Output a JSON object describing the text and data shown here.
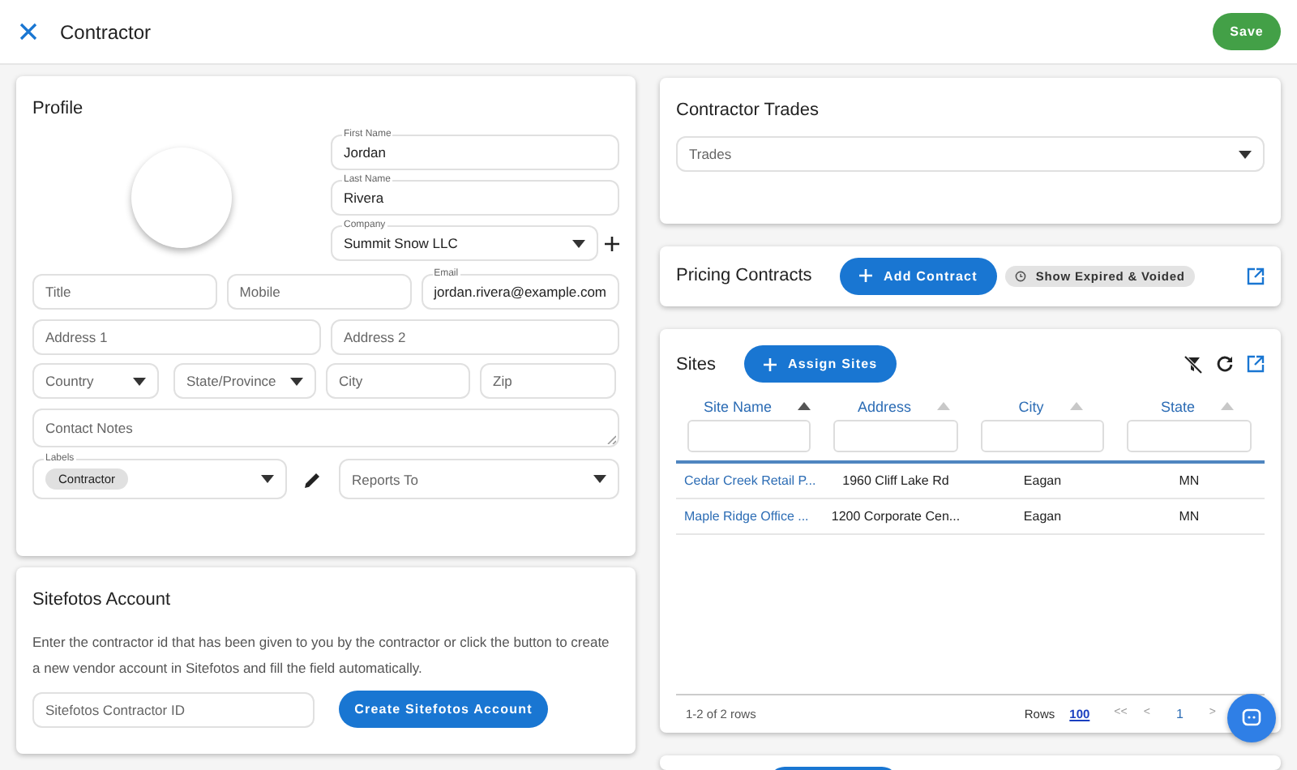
{
  "header": {
    "title": "Contractor",
    "save_button": "Save"
  },
  "profile": {
    "heading": "Profile",
    "first_name": {
      "label": "First Name",
      "value": "Jordan"
    },
    "last_name": {
      "label": "Last Name",
      "value": "Rivera"
    },
    "company": {
      "label": "Company",
      "value": "Summit Snow LLC"
    },
    "title": {
      "placeholder": "Title"
    },
    "mobile": {
      "placeholder": "Mobile"
    },
    "email": {
      "label": "Email",
      "value": "jordan.rivera@example.com"
    },
    "address_1": {
      "placeholder": "Address 1"
    },
    "address_2": {
      "placeholder": "Address 2"
    },
    "country": {
      "placeholder": "Country"
    },
    "state_province": {
      "placeholder": "State/Province"
    },
    "city": {
      "placeholder": "City"
    },
    "zip": {
      "placeholder": "Zip"
    },
    "contact_notes": {
      "placeholder": "Contact Notes"
    },
    "labels": {
      "label": "Labels",
      "chips": [
        "Contractor"
      ]
    },
    "reports_to": {
      "placeholder": "Reports To"
    }
  },
  "sitefotos": {
    "heading": "Sitefotos Account",
    "description": "Enter the contractor id that has been given to you by the contractor or click the button to create a new vendor account in Sitefotos and fill the field automatically.",
    "contractor_id": {
      "placeholder": "Sitefotos Contractor ID"
    },
    "create_button": "Create Sitefotos Account"
  },
  "trades": {
    "heading": "Contractor Trades",
    "trades": {
      "placeholder": "Trades"
    }
  },
  "pricing": {
    "heading": "Pricing Contracts",
    "add_button": "Add Contract",
    "expired_chip": "Show Expired & Voided"
  },
  "sites": {
    "heading": "Sites",
    "assign_button": "Assign Sites",
    "columns": [
      {
        "label": "Site Name",
        "sorted": true
      },
      {
        "label": "Address",
        "sorted": false
      },
      {
        "label": "City",
        "sorted": false
      },
      {
        "label": "State",
        "sorted": false
      }
    ],
    "rows": [
      [
        "Cedar Creek Retail P...",
        "1960 Cliff Lake Rd",
        "Eagan",
        "MN"
      ],
      [
        "Maple Ridge Office ...",
        "1200 Corporate Cen...",
        "Eagan",
        "MN"
      ]
    ],
    "footer": {
      "summary": "1-2 of 2 rows",
      "rows_label": "Rows",
      "rows_value": "100",
      "pages": [
        {
          "label": "<<",
          "selected": false
        },
        {
          "label": "<",
          "selected": false
        },
        {
          "label": "1",
          "selected": true
        },
        {
          "label": ">",
          "selected": false
        }
      ]
    }
  }
}
